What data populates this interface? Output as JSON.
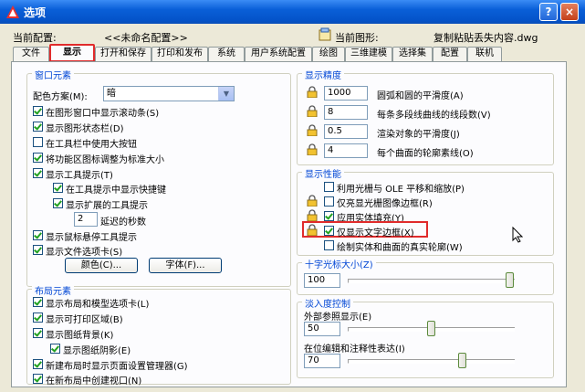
{
  "window": {
    "title": "选项",
    "help": "?",
    "close": "×"
  },
  "header": {
    "profile_label": "当前配置:",
    "profile_value": "<<未命名配置>>",
    "drawing_label": "当前图形:",
    "drawing_value": "复制粘贴丢失内容.dwg"
  },
  "tabs": [
    "文件",
    "显示",
    "打开和保存",
    "打印和发布",
    "系统",
    "用户系统配置",
    "绘图",
    "三维建模",
    "选择集",
    "配置",
    "联机"
  ],
  "window_elements": {
    "title": "窗口元素",
    "scheme_label": "配色方案(M):",
    "scheme_value": "暗",
    "options": [
      {
        "label": "在图形窗口中显示滚动条(S)",
        "checked": true
      },
      {
        "label": "显示图形状态栏(D)",
        "checked": true
      },
      {
        "label": "在工具栏中使用大按钮",
        "checked": false
      },
      {
        "label": "将功能区图标调整为标准大小",
        "checked": true
      },
      {
        "label": "显示工具提示(T)",
        "checked": true
      },
      {
        "label": "在工具提示中显示快捷键",
        "checked": true
      },
      {
        "label": "显示扩展的工具提示",
        "checked": true
      },
      {
        "label": "显示鼠标悬停工具提示",
        "checked": true
      },
      {
        "label": "显示文件选项卡(S)",
        "checked": true
      }
    ],
    "delay_value": "2",
    "delay_label": "延迟的秒数",
    "color_button": "颜色(C)...",
    "font_button": "字体(F)..."
  },
  "layout_elements": {
    "title": "布局元素",
    "options": [
      {
        "label": "显示布局和模型选项卡(L)",
        "checked": true
      },
      {
        "label": "显示可打印区域(B)",
        "checked": true
      },
      {
        "label": "显示图纸背景(K)",
        "checked": true
      },
      {
        "label": "显示图纸阴影(E)",
        "checked": true
      },
      {
        "label": "新建布局时显示页面设置管理器(G)",
        "checked": true
      },
      {
        "label": "在新布局中创建视口(N)",
        "checked": true
      }
    ]
  },
  "display_resolution": {
    "title": "显示精度",
    "rows": [
      {
        "value": "1000",
        "label": "圆弧和圆的平滑度(A)"
      },
      {
        "value": "8",
        "label": "每条多段线曲线的线段数(V)"
      },
      {
        "value": "0.5",
        "label": "渲染对象的平滑度(J)"
      },
      {
        "value": "4",
        "label": "每个曲面的轮廓素线(O)"
      }
    ]
  },
  "display_performance": {
    "title": "显示性能",
    "options": [
      {
        "label": "利用光栅与 OLE 平移和缩放(P)",
        "checked": false
      },
      {
        "label": "仅亮显光栅图像边框(R)",
        "checked": false
      },
      {
        "label": "应用实体填充(Y)",
        "checked": true
      },
      {
        "label": "仅显示文字边框(X)",
        "checked": true
      },
      {
        "label": "绘制实体和曲面的真实轮廓(W)",
        "checked": false
      }
    ]
  },
  "crosshair": {
    "title": "十字光标大小(Z)",
    "value": "100",
    "level": 1.0
  },
  "fade": {
    "title": "淡入度控制",
    "xref_label": "外部参照显示(E)",
    "xref_value": "50",
    "xref_level": 0.5,
    "inplace_label": "在位编辑和注释性表达(I)",
    "inplace_value": "70",
    "inplace_level": 0.7
  },
  "colors": {
    "accent": "#0046d5",
    "highlight": "#e02b2b",
    "titlebar": "#0453c9"
  },
  "icons": {
    "app": "autocad-icon",
    "drawing": "drawing-icon",
    "lock": "lock-icon",
    "cursor": "mouse-pointer-icon"
  }
}
